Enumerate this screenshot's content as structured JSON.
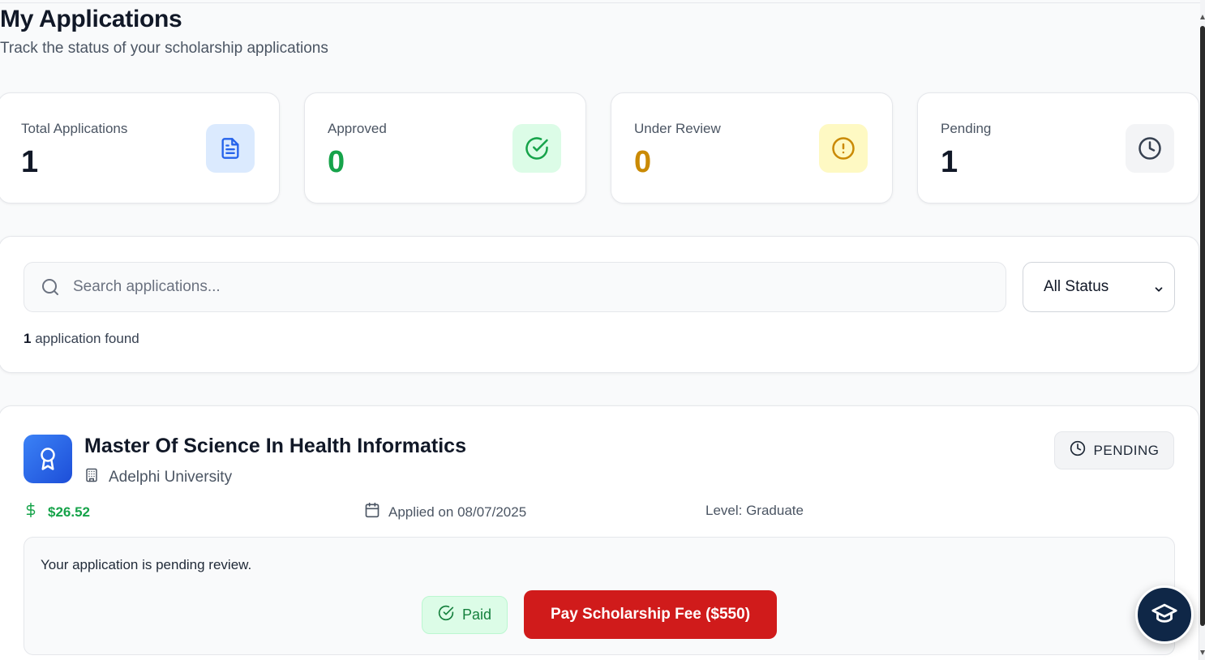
{
  "header": {
    "title": "My Applications",
    "subtitle": "Track the status of your scholarship applications"
  },
  "stats": [
    {
      "label": "Total Applications",
      "value": "1",
      "icon": "document-icon",
      "value_color": "#111827",
      "icon_bg": "#dbeafe",
      "icon_color": "#2563eb"
    },
    {
      "label": "Approved",
      "value": "0",
      "icon": "check-circle-icon",
      "value_color": "#16a34a",
      "icon_bg": "#dcfce7",
      "icon_color": "#16a34a"
    },
    {
      "label": "Under Review",
      "value": "0",
      "icon": "alert-circle-icon",
      "value_color": "#ca8a04",
      "icon_bg": "#fef9c3",
      "icon_color": "#ca8a04"
    },
    {
      "label": "Pending",
      "value": "1",
      "icon": "clock-icon",
      "value_color": "#111827",
      "icon_bg": "#f3f4f6",
      "icon_color": "#374151"
    }
  ],
  "filters": {
    "search_placeholder": "Search applications...",
    "status_selected": "All Status",
    "count": "1",
    "count_suffix": " application found"
  },
  "application": {
    "title": "Master Of Science In Health Informatics",
    "university": "Adelphi University",
    "status": "PENDING",
    "amount": "$26.52",
    "applied_on": "Applied on 08/07/2025",
    "level": "Level: Graduate",
    "notice": "Your application is pending review.",
    "paid_label": "Paid",
    "pay_button_label": "Pay Scholarship Fee ($550)"
  },
  "colors": {
    "primary_blue": "#2563eb",
    "success_green": "#16a34a",
    "warning_yellow": "#ca8a04",
    "danger_red": "#d01b1b",
    "fab_navy": "#0f2747"
  }
}
